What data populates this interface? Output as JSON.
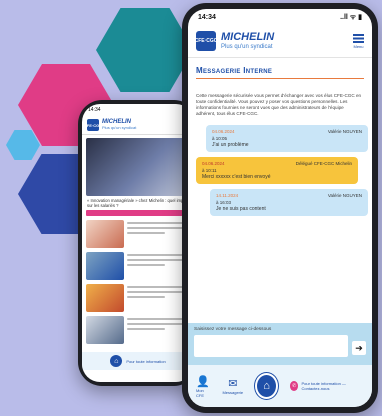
{
  "decor": {
    "hex_colors": [
      "#1b8b95",
      "#e03c86",
      "#56b9e8",
      "#2f49a6"
    ],
    "background": "#b9bce9"
  },
  "phone_front": {
    "status": {
      "time": "14:34",
      "signal": "..ll ᯤ ▮"
    },
    "header": {
      "logo_text": "CFE·CGC",
      "brand": "MICHELIN",
      "tagline": "Plus qu'un syndicat",
      "menu_label": "Menu",
      "menu_icon": "hamburger-icon"
    },
    "page_title": "Messagerie Interne",
    "intro": "Cette messagerie sécurisée vous permet d'échanger avec vos élus CFE-CGC en toute confidentialité. Vous pouvez y poser vos questions personnelles. Les informations fournies ne seront vues que des administrateurs de l'équipe adhérent, tous élus CFE-CGC.",
    "messages": [
      {
        "date": "04.06.2024",
        "author": "Valérie NGUYEN",
        "time": "à 10:05",
        "text": "J'ai un problème"
      },
      {
        "date": "04.06.2024",
        "author": "Délégué CFE-CGC Michelin",
        "time": "à 10:11",
        "text": "Merci xxxxxx c'est bien envoyé"
      },
      {
        "date": "14.11.2024",
        "author": "Valérie NGUYEN",
        "time": "à 16:03",
        "text": "Je ne suis pas content"
      }
    ],
    "composer": {
      "placeholder": "Saisissez votre message ci-dessous",
      "send_icon": "arrow-right-icon"
    },
    "bottom_nav": {
      "profile_label": "Mon CFE",
      "messages_label": "Messagerie",
      "home_icon": "home-icon",
      "promo_text": "Pour toute information — Contactez-nous"
    }
  },
  "phone_back": {
    "status": {
      "time": "14:34"
    },
    "header": {
      "logo_text": "CFE·CGC",
      "brand": "MICHELIN",
      "tagline": "Plus qu'un syndicat"
    },
    "hero_caption": "« Innovation managériale » chez Michelin : quel impact sur les salariés ?",
    "cta_label": "Pour toute information",
    "home_icon": "home-icon"
  }
}
